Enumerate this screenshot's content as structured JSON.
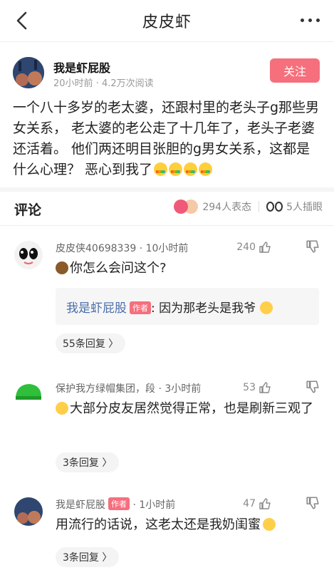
{
  "header": {
    "title": "皮皮虾"
  },
  "post": {
    "author": "我是虾屁股",
    "meta": "20小时前 · 4.2万次阅读",
    "follow_label": "关注",
    "body": "一个八十多岁的老太婆，还跟村里的老头子g那些男女关系， 老太婆的老公走了十几年了，老头子老婆还活着。 他们两还明目张胆的g男女关系，这都是什么心理？ 恶心到我了"
  },
  "comments_section": {
    "title": "评论",
    "reactions_label": "294人表态",
    "illustrations_label": "5人插眼"
  },
  "comments": [
    {
      "author": "皮皮侠40698339",
      "time": "· 10小时前",
      "likes": "240",
      "text": "你怎么会问这个?",
      "reply_author": "我是虾屁股",
      "reply_tag": "作者",
      "reply_text": ": 因为那老头是我爷",
      "reply_count": "55条回复 〉"
    },
    {
      "author": "保护我方绿帽集团，段",
      "time": "· 3小时前",
      "likes": "53",
      "text": "大部分皮友居然觉得正常，也是刷新三观了",
      "reply_count": "3条回复 〉"
    },
    {
      "author": "我是虾屁股",
      "tag": "作者",
      "time": "· 1小时前",
      "likes": "47",
      "text": "用流行的话说，这老太还是我奶闺蜜",
      "reply_count": "3条回复 〉"
    }
  ]
}
